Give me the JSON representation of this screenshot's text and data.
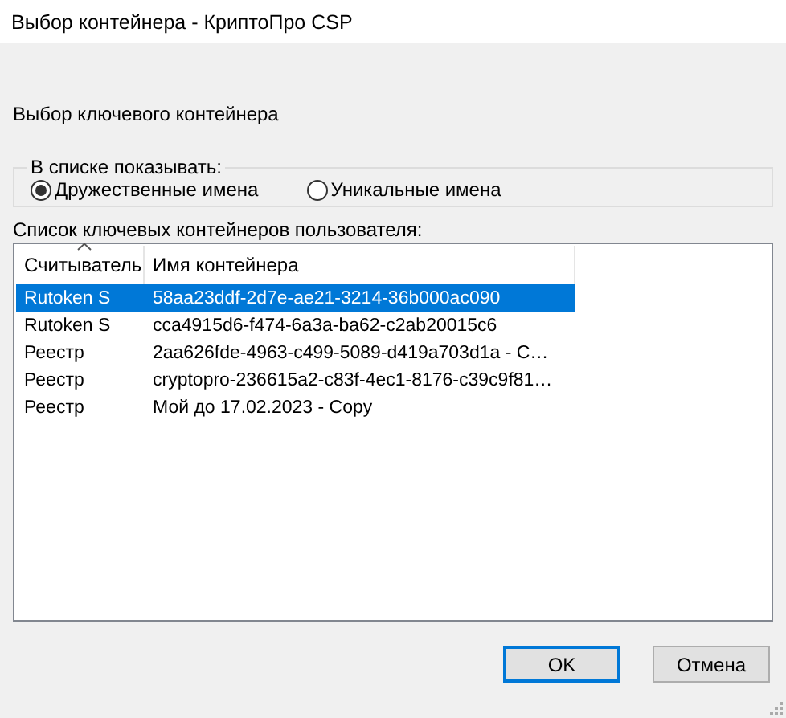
{
  "window": {
    "title": "Выбор контейнера - КриптоПро CSP"
  },
  "heading": "Выбор ключевого контейнера",
  "display_group": {
    "legend": "В списке показывать:",
    "options": [
      {
        "label": "Дружественные имена",
        "selected": true
      },
      {
        "label": "Уникальные имена",
        "selected": false
      }
    ]
  },
  "container_list": {
    "label": "Список ключевых контейнеров пользователя:",
    "columns": [
      {
        "label": "Считыватель",
        "sorted": true
      },
      {
        "label": "Имя контейнера",
        "sorted": false
      }
    ],
    "rows": [
      {
        "cells": [
          "Rutoken S",
          "58aa23ddf-2d7e-ae21-3214-36b000ac090"
        ],
        "selected": true
      },
      {
        "cells": [
          "Rutoken S",
          "cca4915d6-f474-6a3a-ba62-c2ab20015c6"
        ],
        "selected": false
      },
      {
        "cells": [
          "Реестр",
          "2aa626fde-4963-c499-5089-d419a703d1a - C…"
        ],
        "selected": false
      },
      {
        "cells": [
          "Реестр",
          "cryptopro-236615a2-c83f-4ec1-8176-c39c9f81…"
        ],
        "selected": false
      },
      {
        "cells": [
          "Реестр",
          "Мой до 17.02.2023 - Copy"
        ],
        "selected": false
      }
    ]
  },
  "buttons": [
    {
      "label": "OK",
      "default": true
    },
    {
      "label": "Отмена",
      "default": false
    }
  ]
}
